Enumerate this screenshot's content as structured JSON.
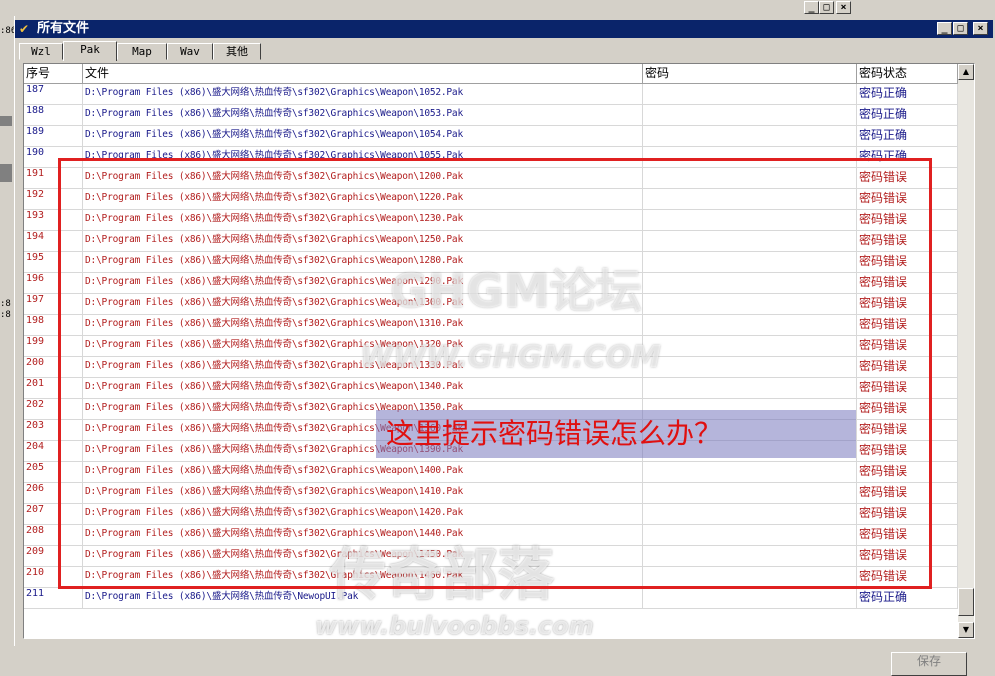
{
  "background_window": {
    "buttons": [
      "_",
      "□",
      "×"
    ]
  },
  "left_strip_fragments": [
    ":86",
    ":8",
    ":8"
  ],
  "window": {
    "title": "所有文件",
    "controls": [
      "_",
      "□",
      "×"
    ]
  },
  "tabs": [
    {
      "label": "Wzl",
      "active": false
    },
    {
      "label": "Pak",
      "active": true
    },
    {
      "label": "Map",
      "active": false
    },
    {
      "label": "Wav",
      "active": false
    },
    {
      "label": "其他",
      "active": false
    }
  ],
  "table": {
    "columns": [
      "序号",
      "文件",
      "密码",
      "密码状态"
    ],
    "rows": [
      {
        "no": "187",
        "file": "D:\\Program Files (x86)\\盛大网络\\热血传奇\\sf302\\Graphics\\Weapon\\1052.Pak",
        "password": "",
        "status": "密码正确",
        "ok": true
      },
      {
        "no": "188",
        "file": "D:\\Program Files (x86)\\盛大网络\\热血传奇\\sf302\\Graphics\\Weapon\\1053.Pak",
        "password": "",
        "status": "密码正确",
        "ok": true
      },
      {
        "no": "189",
        "file": "D:\\Program Files (x86)\\盛大网络\\热血传奇\\sf302\\Graphics\\Weapon\\1054.Pak",
        "password": "",
        "status": "密码正确",
        "ok": true
      },
      {
        "no": "190",
        "file": "D:\\Program Files (x86)\\盛大网络\\热血传奇\\sf302\\Graphics\\Weapon\\1055.Pak",
        "password": "",
        "status": "密码正确",
        "ok": true
      },
      {
        "no": "191",
        "file": "D:\\Program Files (x86)\\盛大网络\\热血传奇\\sf302\\Graphics\\Weapon\\1200.Pak",
        "password": "",
        "status": "密码错误",
        "ok": false
      },
      {
        "no": "192",
        "file": "D:\\Program Files (x86)\\盛大网络\\热血传奇\\sf302\\Graphics\\Weapon\\1220.Pak",
        "password": "",
        "status": "密码错误",
        "ok": false
      },
      {
        "no": "193",
        "file": "D:\\Program Files (x86)\\盛大网络\\热血传奇\\sf302\\Graphics\\Weapon\\1230.Pak",
        "password": "",
        "status": "密码错误",
        "ok": false
      },
      {
        "no": "194",
        "file": "D:\\Program Files (x86)\\盛大网络\\热血传奇\\sf302\\Graphics\\Weapon\\1250.Pak",
        "password": "",
        "status": "密码错误",
        "ok": false
      },
      {
        "no": "195",
        "file": "D:\\Program Files (x86)\\盛大网络\\热血传奇\\sf302\\Graphics\\Weapon\\1280.Pak",
        "password": "",
        "status": "密码错误",
        "ok": false
      },
      {
        "no": "196",
        "file": "D:\\Program Files (x86)\\盛大网络\\热血传奇\\sf302\\Graphics\\Weapon\\1290.Pak",
        "password": "",
        "status": "密码错误",
        "ok": false
      },
      {
        "no": "197",
        "file": "D:\\Program Files (x86)\\盛大网络\\热血传奇\\sf302\\Graphics\\Weapon\\1300.Pak",
        "password": "",
        "status": "密码错误",
        "ok": false
      },
      {
        "no": "198",
        "file": "D:\\Program Files (x86)\\盛大网络\\热血传奇\\sf302\\Graphics\\Weapon\\1310.Pak",
        "password": "",
        "status": "密码错误",
        "ok": false
      },
      {
        "no": "199",
        "file": "D:\\Program Files (x86)\\盛大网络\\热血传奇\\sf302\\Graphics\\Weapon\\1320.Pak",
        "password": "",
        "status": "密码错误",
        "ok": false
      },
      {
        "no": "200",
        "file": "D:\\Program Files (x86)\\盛大网络\\热血传奇\\sf302\\Graphics\\Weapon\\1330.Pak",
        "password": "",
        "status": "密码错误",
        "ok": false
      },
      {
        "no": "201",
        "file": "D:\\Program Files (x86)\\盛大网络\\热血传奇\\sf302\\Graphics\\Weapon\\1340.Pak",
        "password": "",
        "status": "密码错误",
        "ok": false
      },
      {
        "no": "202",
        "file": "D:\\Program Files (x86)\\盛大网络\\热血传奇\\sf302\\Graphics\\Weapon\\1350.Pak",
        "password": "",
        "status": "密码错误",
        "ok": false
      },
      {
        "no": "203",
        "file": "D:\\Program Files (x86)\\盛大网络\\热血传奇\\sf302\\Graphics\\Weapon\\1360.Pak",
        "password": "",
        "status": "密码错误",
        "ok": false
      },
      {
        "no": "204",
        "file": "D:\\Program Files (x86)\\盛大网络\\热血传奇\\sf302\\Graphics\\Weapon\\1390.Pak",
        "password": "",
        "status": "密码错误",
        "ok": false
      },
      {
        "no": "205",
        "file": "D:\\Program Files (x86)\\盛大网络\\热血传奇\\sf302\\Graphics\\Weapon\\1400.Pak",
        "password": "",
        "status": "密码错误",
        "ok": false
      },
      {
        "no": "206",
        "file": "D:\\Program Files (x86)\\盛大网络\\热血传奇\\sf302\\Graphics\\Weapon\\1410.Pak",
        "password": "",
        "status": "密码错误",
        "ok": false
      },
      {
        "no": "207",
        "file": "D:\\Program Files (x86)\\盛大网络\\热血传奇\\sf302\\Graphics\\Weapon\\1420.Pak",
        "password": "",
        "status": "密码错误",
        "ok": false
      },
      {
        "no": "208",
        "file": "D:\\Program Files (x86)\\盛大网络\\热血传奇\\sf302\\Graphics\\Weapon\\1440.Pak",
        "password": "",
        "status": "密码错误",
        "ok": false
      },
      {
        "no": "209",
        "file": "D:\\Program Files (x86)\\盛大网络\\热血传奇\\sf302\\Graphics\\Weapon\\1450.Pak",
        "password": "",
        "status": "密码错误",
        "ok": false
      },
      {
        "no": "210",
        "file": "D:\\Program Files (x86)\\盛大网络\\热血传奇\\sf302\\Graphics\\Weapon\\1460.Pak",
        "password": "",
        "status": "密码错误",
        "ok": false
      },
      {
        "no": "211",
        "file": "D:\\Program Files (x86)\\盛大网络\\热血传奇\\NewopUI.Pak",
        "password": "",
        "status": "密码正确",
        "ok": true
      }
    ]
  },
  "annotation": "这里提示密码错误怎么办？",
  "watermarks": [
    "GHGM论坛",
    "WWW.GHGM.COM",
    "传奇部落",
    "www.bulvoobbs.com"
  ],
  "save_button_label": "保存",
  "colors": {
    "title_bar": "#0a246a",
    "ok_text": "#1a1a8a",
    "error_text": "#b21e1e",
    "highlight_box": "#e02020"
  }
}
